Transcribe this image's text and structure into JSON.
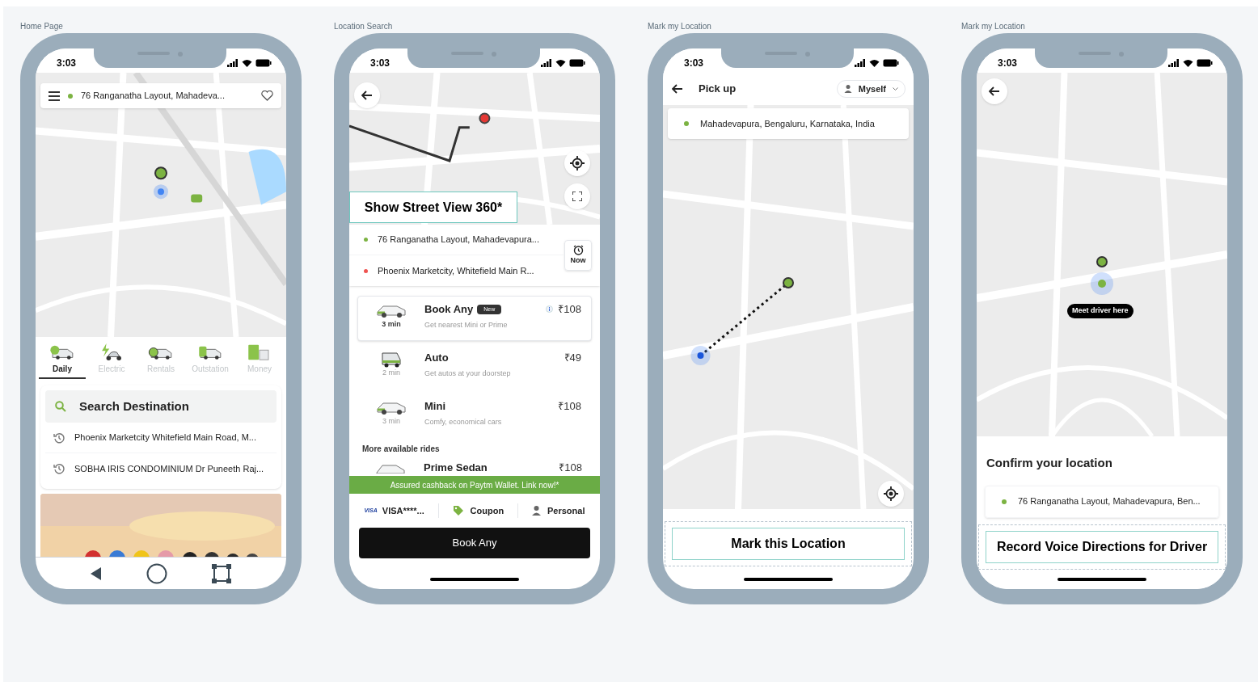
{
  "screens": [
    {
      "kind": "home",
      "caption": "Home Page",
      "time": "3:03",
      "address": "76 Ranganatha Layout, Mahadeva...",
      "services": [
        {
          "label": "Daily",
          "selected": true
        },
        {
          "label": "Electric",
          "selected": false
        },
        {
          "label": "Rentals",
          "selected": false
        },
        {
          "label": "Outstation",
          "selected": false
        },
        {
          "label": "Money",
          "selected": false
        }
      ],
      "search_label": "Search Destination",
      "recent": [
        "Phoenix Marketcity Whitefield Main Road, M...",
        "SOBHA IRIS CONDOMINIUM Dr Puneeth Raj..."
      ]
    },
    {
      "kind": "search",
      "caption": "Location Search",
      "time": "3:03",
      "street_view": "Show Street View 360*",
      "pickup": "76 Ranganatha Layout, Mahadevapura...",
      "drop": "Phoenix Marketcity, Whitefield Main R...",
      "schedule": "Now",
      "rides": [
        {
          "name": "Book Any",
          "badge": "New",
          "eta": "3 min",
          "note": "Get nearest Mini or Prime",
          "price": "₹108",
          "selected": true
        },
        {
          "name": "Auto",
          "eta": "2 min",
          "note": "Get autos at your doorstep",
          "price": "₹49",
          "selected": false
        },
        {
          "name": "Mini",
          "eta": "3 min",
          "note": "Comfy, economical cars",
          "price": "₹108",
          "selected": false
        }
      ],
      "more_heading": "More available rides",
      "more_rides": [
        {
          "name": "Prime Sedan",
          "price": "₹108"
        }
      ],
      "banner": "Assured cashback on Paytm Wallet. Link now!*",
      "payment": {
        "card_brand": "VISA",
        "card": "VISA****...",
        "coupon": "Coupon",
        "profile": "Personal"
      },
      "action": "Book Any"
    },
    {
      "kind": "mark",
      "caption": "Mark my Location",
      "time": "3:03",
      "title": "Pick up",
      "rider": "Myself",
      "location": "Mahadevapura, Bengaluru, Karnataka, India",
      "action": "Mark this Location"
    },
    {
      "kind": "confirm",
      "caption": "Mark my Location",
      "time": "3:03",
      "pin_label": "Meet driver here",
      "heading": "Confirm your location",
      "address": "76 Ranganatha Layout, Mahadevapura, Ben...",
      "action": "Record Voice Directions for Driver"
    }
  ]
}
